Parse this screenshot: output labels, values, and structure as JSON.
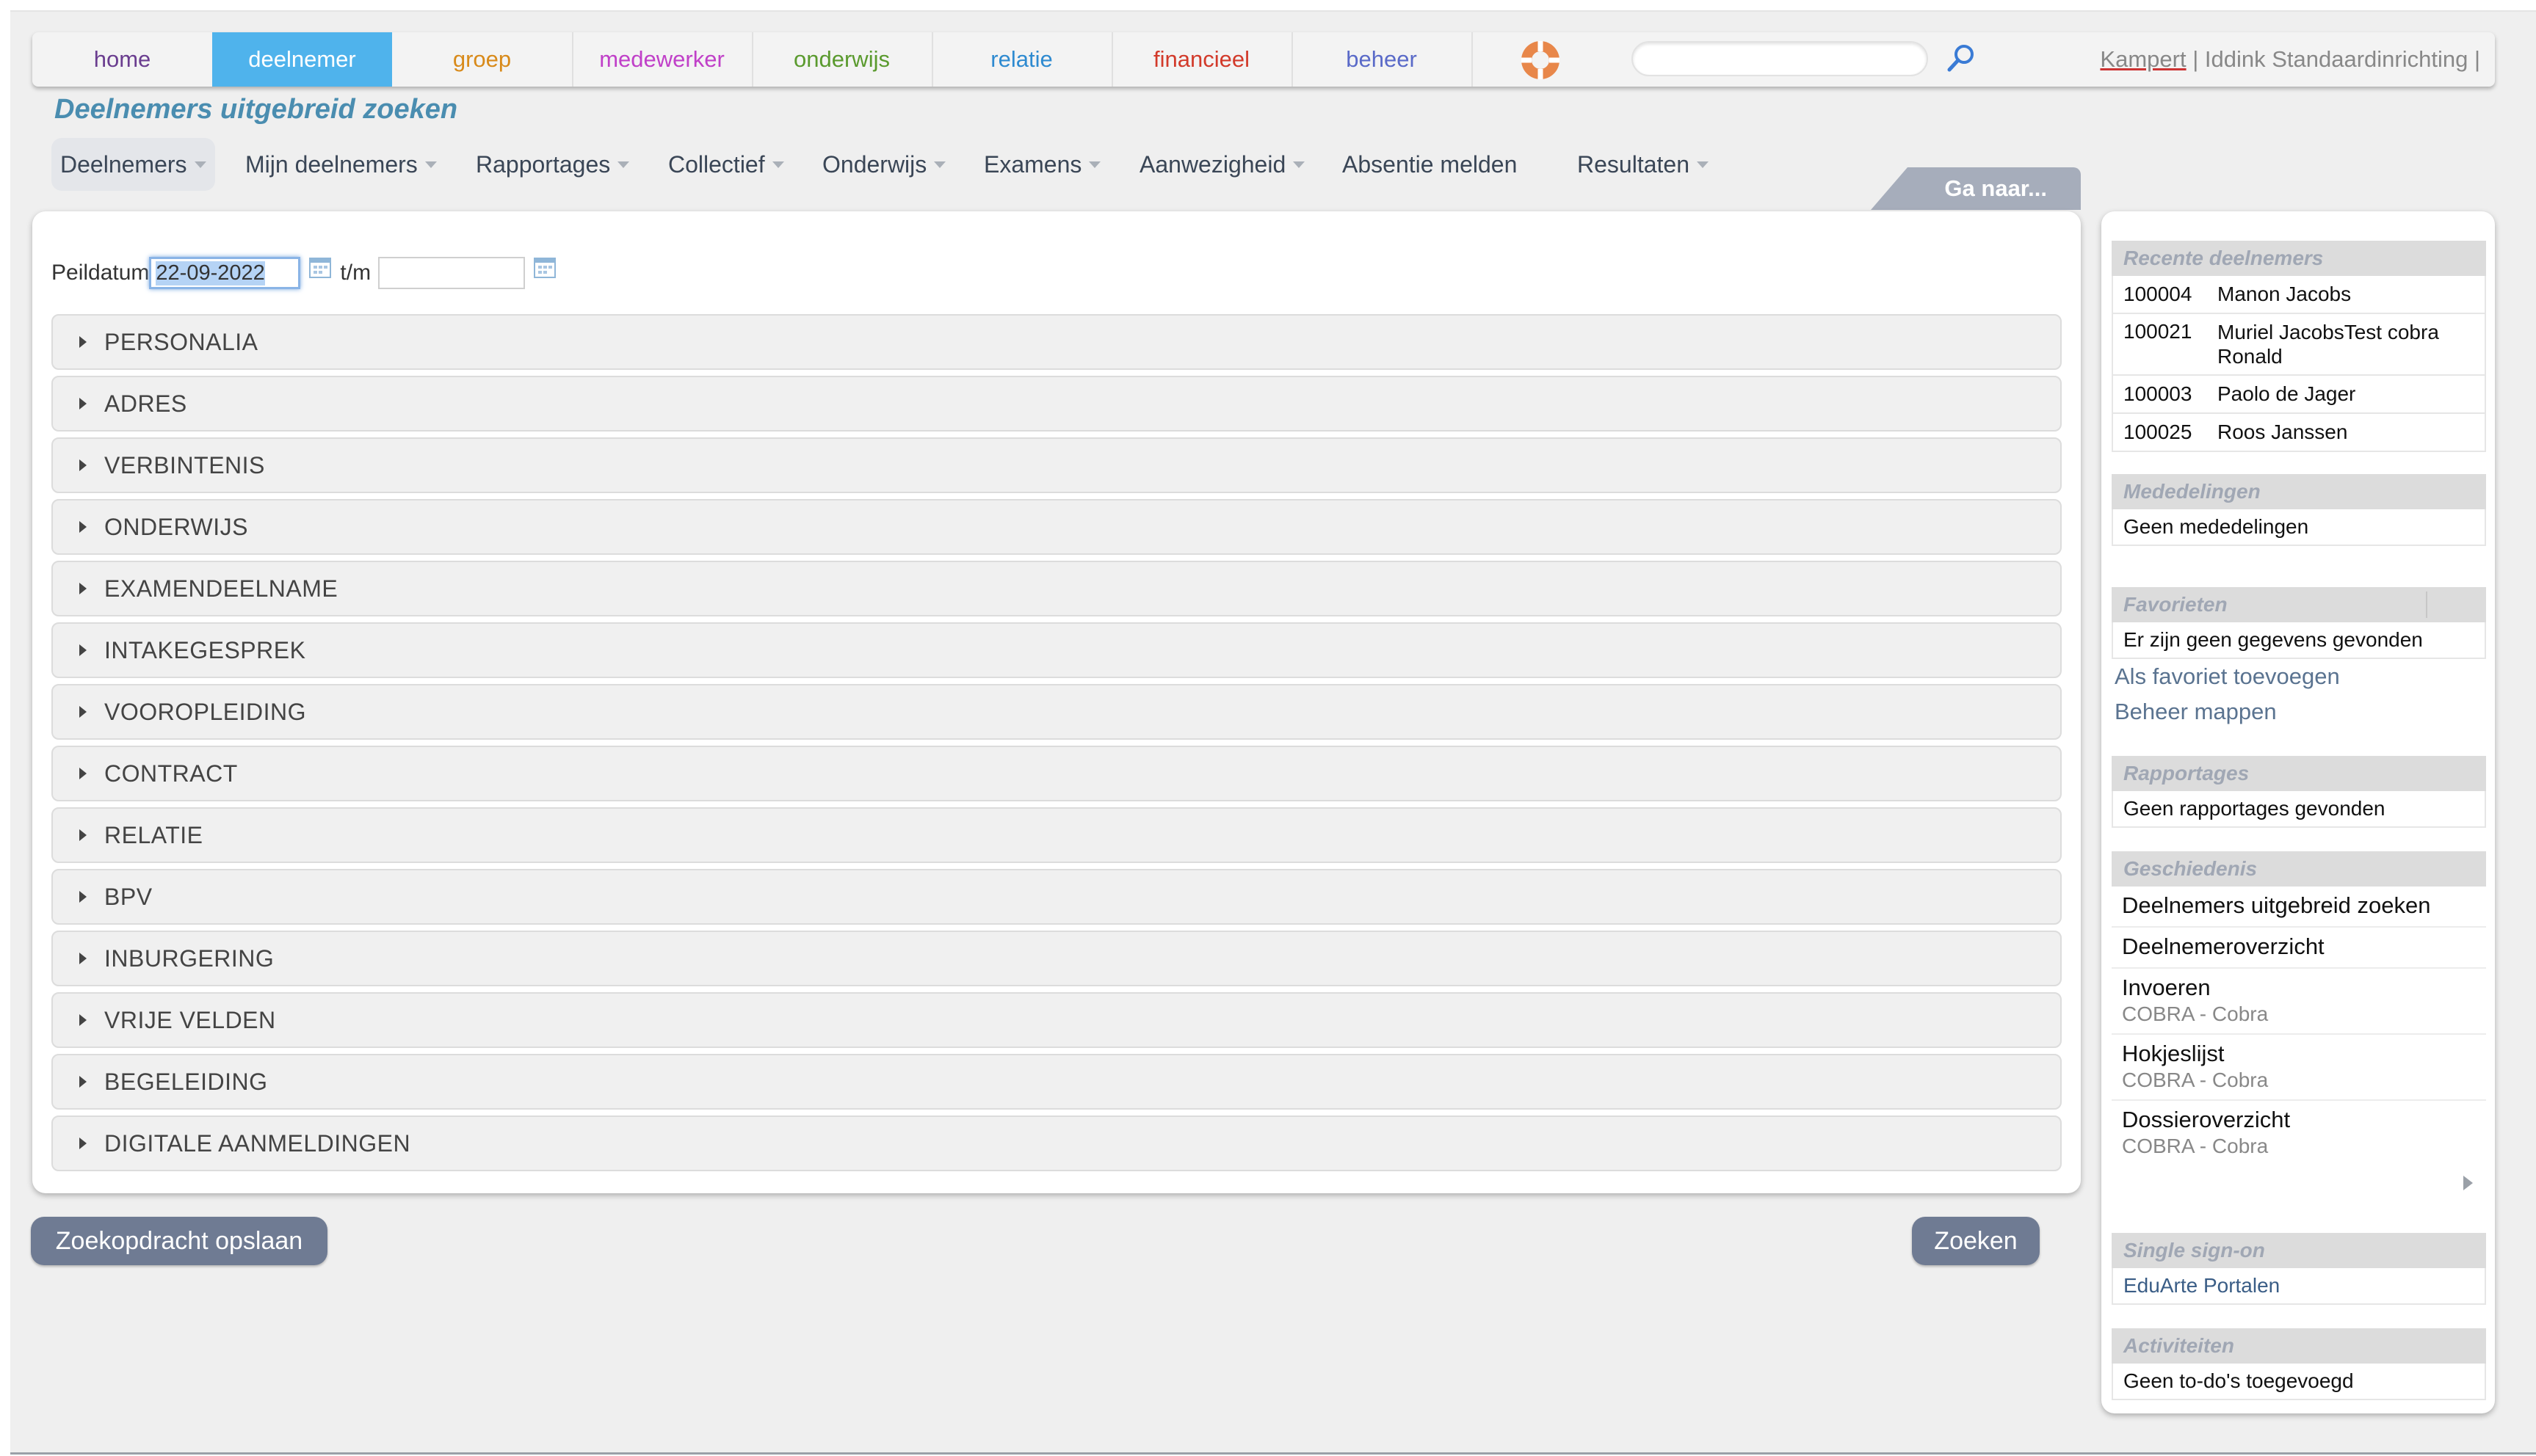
{
  "topnav": {
    "tabs": [
      {
        "label": "home",
        "color": "#6a3d8f"
      },
      {
        "label": "deelnemer",
        "color": "#ffffff"
      },
      {
        "label": "groep",
        "color": "#d88a1a"
      },
      {
        "label": "medewerker",
        "color": "#c040c8"
      },
      {
        "label": "onderwijs",
        "color": "#5a9a2e"
      },
      {
        "label": "relatie",
        "color": "#2e8ad0"
      },
      {
        "label": "financieel",
        "color": "#d23a2a"
      },
      {
        "label": "beheer",
        "color": "#5a6ac8"
      }
    ],
    "active_tab": "deelnemer",
    "search_placeholder": "",
    "user_location": "Kampert",
    "user_separator": " | ",
    "organisation": "Iddink Standaardinrichting",
    "user_trailing": " |"
  },
  "page": {
    "title": "Deelnemers uitgebreid zoeken"
  },
  "submenu": {
    "items": [
      {
        "label": "Deelnemers",
        "dropdown": true
      },
      {
        "label": "Mijn deelnemers",
        "dropdown": true
      },
      {
        "label": "Rapportages",
        "dropdown": true
      },
      {
        "label": "Collectief",
        "dropdown": true
      },
      {
        "label": "Onderwijs",
        "dropdown": true
      },
      {
        "label": "Examens",
        "dropdown": true
      },
      {
        "label": "Aanwezigheid",
        "dropdown": true
      },
      {
        "label": "Absentie melden",
        "dropdown": false
      },
      {
        "label": "Resultaten",
        "dropdown": true
      }
    ],
    "ga_naar": "Ga naar..."
  },
  "form": {
    "peildatum_label": "Peildatum",
    "peildatum_value": "22-09-2022",
    "tm_label": "t/m",
    "tm_value": ""
  },
  "sections": [
    "PERSONALIA",
    "ADRES",
    "VERBINTENIS",
    "ONDERWIJS",
    "EXAMENDEELNAME",
    "INTAKEGESPREK",
    "VOOROPLEIDING",
    "CONTRACT",
    "RELATIE",
    "BPV",
    "INBURGERING",
    "VRIJE VELDEN",
    "BEGELEIDING",
    "DIGITALE AANMELDINGEN"
  ],
  "buttons": {
    "save_search": "Zoekopdracht opslaan",
    "search": "Zoeken"
  },
  "sidebar": {
    "recent": {
      "title": "Recente deelnemers",
      "rows": [
        {
          "number": "100004",
          "name": "Manon Jacobs"
        },
        {
          "number": "100021",
          "name": "Muriel JacobsTest cobra Ronald"
        },
        {
          "number": "100003",
          "name": "Paolo de Jager"
        },
        {
          "number": "100025",
          "name": "Roos Janssen"
        }
      ]
    },
    "mededelingen": {
      "title": "Mededelingen",
      "empty": "Geen mededelingen"
    },
    "favorieten": {
      "title": "Favorieten",
      "empty": "Er zijn geen gegevens gevonden",
      "add_link": "Als favoriet toevoegen",
      "manage_link": "Beheer mappen"
    },
    "rapportages": {
      "title": "Rapportages",
      "empty": "Geen rapportages gevonden"
    },
    "geschiedenis": {
      "title": "Geschiedenis",
      "items": [
        {
          "title": "Deelnemers uitgebreid zoeken",
          "sub": ""
        },
        {
          "title": "Deelnemeroverzicht",
          "sub": ""
        },
        {
          "title": "Invoeren",
          "sub": "COBRA - Cobra"
        },
        {
          "title": "Hokjeslijst",
          "sub": "COBRA - Cobra"
        },
        {
          "title": "Dossieroverzicht",
          "sub": "COBRA - Cobra"
        }
      ]
    },
    "sso": {
      "title": "Single sign-on",
      "link": "EduArte Portalen"
    },
    "activiteiten": {
      "title": "Activiteiten",
      "empty": "Geen to-do's toegevoegd"
    }
  }
}
